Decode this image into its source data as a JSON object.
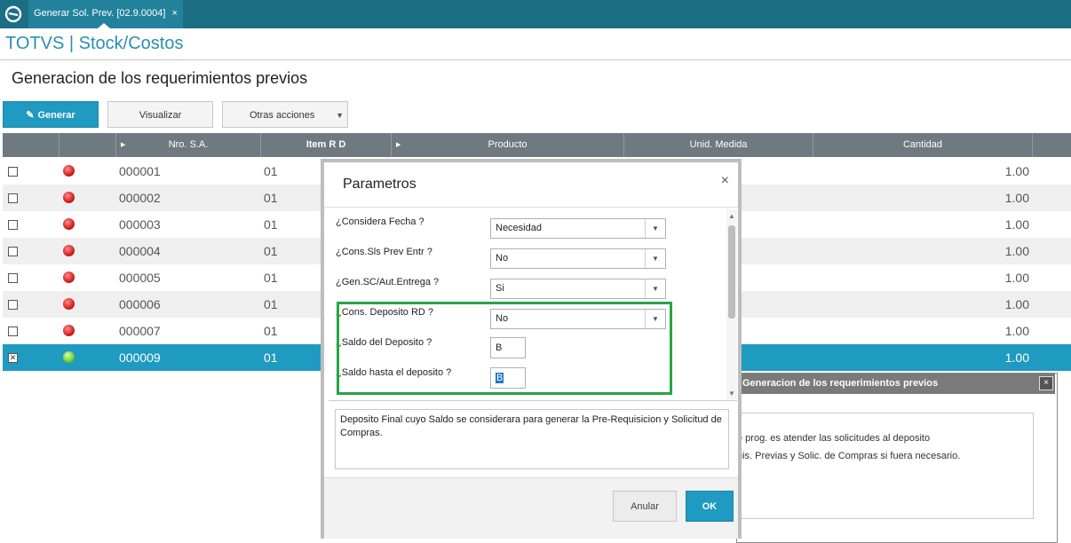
{
  "topbar": {
    "tab_label": "Generar Sol. Prev. [02.9.0004]",
    "tab_close": "×"
  },
  "header": {
    "brand": "TOTVS | Stock/Costos"
  },
  "page": {
    "title": "Generacion de los requerimientos previos"
  },
  "toolbar": {
    "generar": "Generar",
    "visualizar": "Visualizar",
    "otras": "Otras acciones"
  },
  "grid": {
    "columns": [
      "Nro. S.A.",
      "Item R D",
      "Producto",
      "Unid. Medida",
      "Cantidad"
    ],
    "rows": [
      {
        "checked": false,
        "status": "red",
        "nro": "000001",
        "item": "01",
        "cantidad": "1.00"
      },
      {
        "checked": false,
        "status": "red",
        "nro": "000002",
        "item": "01",
        "cantidad": "1.00"
      },
      {
        "checked": false,
        "status": "red",
        "nro": "000003",
        "item": "01",
        "cantidad": "1.00"
      },
      {
        "checked": false,
        "status": "red",
        "nro": "000004",
        "item": "01",
        "cantidad": "1.00"
      },
      {
        "checked": false,
        "status": "red",
        "nro": "000005",
        "item": "01",
        "cantidad": "1.00"
      },
      {
        "checked": false,
        "status": "red",
        "nro": "000006",
        "item": "01",
        "cantidad": "1.00"
      },
      {
        "checked": false,
        "status": "red",
        "nro": "000007",
        "item": "01",
        "cantidad": "1.00"
      },
      {
        "checked": true,
        "status": "green",
        "nro": "000009",
        "item": "01",
        "cantidad": "1.00"
      }
    ]
  },
  "bg_dialog": {
    "title": "Generacion de los requerimientos previos",
    "close": "×",
    "line1": "e prog. es atender las solicitudes al deposito",
    "line2": "uis. Previas y Solic. de Compras si fuera necesario."
  },
  "modal": {
    "title": "Parametros",
    "close": "×",
    "params": [
      {
        "label": "¿Considera Fecha ?",
        "value": "Necesidad"
      },
      {
        "label": "¿Cons.Sls Prev Entr ?",
        "value": "No"
      },
      {
        "label": "¿Gen.SC/Aut.Entrega ?",
        "value": "Si"
      },
      {
        "label": "¿Cons. Deposito RD ?",
        "value": "No"
      },
      {
        "label": "¿Saldo del Deposito ?",
        "value": "B"
      },
      {
        "label": "¿Saldo hasta el deposito ?",
        "value": "B"
      }
    ],
    "description": "Deposito Final cuyo Saldo se considerara para generar la Pre-Requisicion y Solicitud de Compras.",
    "cancel": "Anular",
    "ok": "OK"
  },
  "colors": {
    "topbar": "#1b6e84",
    "accent": "#1f9ac0",
    "highlight_box": "#26a644",
    "grid_header": "#6e7a80"
  }
}
